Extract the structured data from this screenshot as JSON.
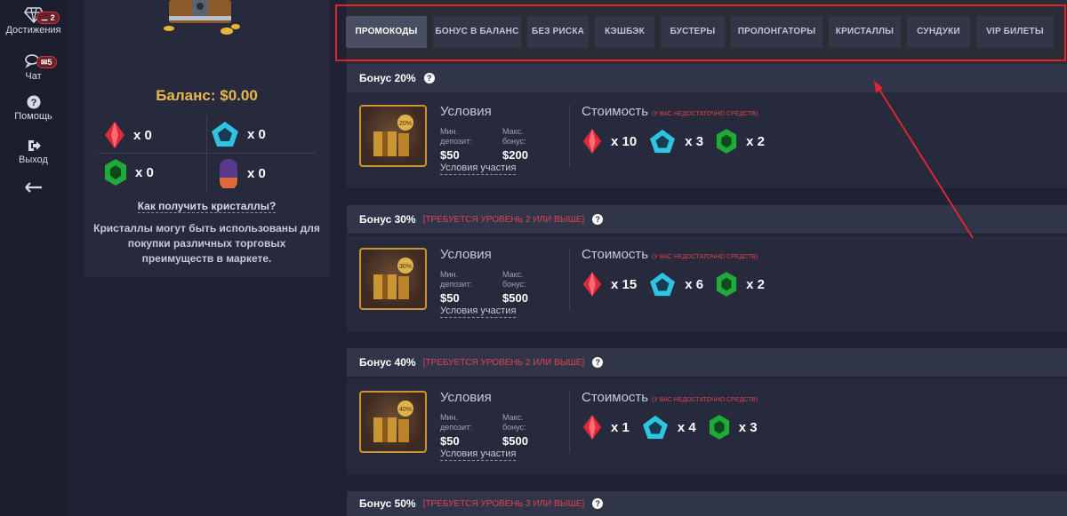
{
  "nav": {
    "achievements": {
      "label": "Достижения",
      "badge": "2"
    },
    "chat": {
      "label": "Чат",
      "badge": "5"
    },
    "help": {
      "label": "Помощь"
    },
    "logout": {
      "label": "Выход"
    }
  },
  "account": {
    "balance": "Баланс: $0.00",
    "crystals": [
      {
        "type": "red",
        "count": "x 0"
      },
      {
        "type": "blue",
        "count": "x 0"
      },
      {
        "type": "green",
        "count": "x 0"
      },
      {
        "type": "purple",
        "count": "x 0"
      }
    ],
    "how_to_get": "Как получить кристаллы?",
    "note": "Кристаллы могут быть использованы для покупки различных торговых преимуществ в маркете."
  },
  "tabs": [
    "ПРОМОКОДЫ",
    "БОНУС В БАЛАНС",
    "БЕЗ РИСКА",
    "КЭШБЭК",
    "БУСТЕРЫ",
    "ПРОЛОНГАТОРЫ",
    "КРИСТАЛЛЫ",
    "СУНДУКИ",
    "VIP БИЛЕТЫ"
  ],
  "active_tab": "ПРОМОКОДЫ",
  "bonuses": [
    {
      "title": "Бонус 20%",
      "requirement": "",
      "badge": "20%",
      "conditions_title": "Условия",
      "min_label": "Мин. депозит:",
      "min_value": "$50",
      "max_label": "Макс. бонус:",
      "max_value": "$200",
      "conditions_link": "Условия участия",
      "cost_title": "Стоимость",
      "cost_note": "(У ВАС НЕДОСТАТОЧНО СРЕДСТВ)",
      "cost": [
        "x 10",
        "x 3",
        "x 2"
      ]
    },
    {
      "title": "Бонус 30%",
      "requirement": "[ТРЕБУЕТСЯ УРОВЕНЬ 2 ИЛИ ВЫШЕ]",
      "badge": "30%",
      "conditions_title": "Условия",
      "min_label": "Мин. депозит:",
      "min_value": "$50",
      "max_label": "Макс. бонус:",
      "max_value": "$500",
      "conditions_link": "Условия участия",
      "cost_title": "Стоимость",
      "cost_note": "(У ВАС НЕДОСТАТОЧНО СРЕДСТВ)",
      "cost": [
        "x 15",
        "x 6",
        "x 2"
      ]
    },
    {
      "title": "Бонус 40%",
      "requirement": "[ТРЕБУЕТСЯ УРОВЕНЬ 2 ИЛИ ВЫШЕ]",
      "badge": "40%",
      "conditions_title": "Условия",
      "min_label": "Мин. депозит:",
      "min_value": "$50",
      "max_label": "Макс. бонус:",
      "max_value": "$500",
      "conditions_link": "Условия участия",
      "cost_title": "Стоимость",
      "cost_note": "(У ВАС НЕДОСТАТОЧНО СРЕДСТВ)",
      "cost": [
        "x 1",
        "x 4",
        "x 3"
      ]
    },
    {
      "title": "Бонус 50%",
      "requirement": "[ТРЕБУЕТСЯ УРОВЕНЬ 3 ИЛИ ВЫШЕ]"
    }
  ],
  "colors": {
    "accent": "#e8b64c",
    "highlight": "#e0242f",
    "red_gem": "#e0283a",
    "blue_gem": "#2fc4e0",
    "green_gem": "#1faa3a"
  }
}
